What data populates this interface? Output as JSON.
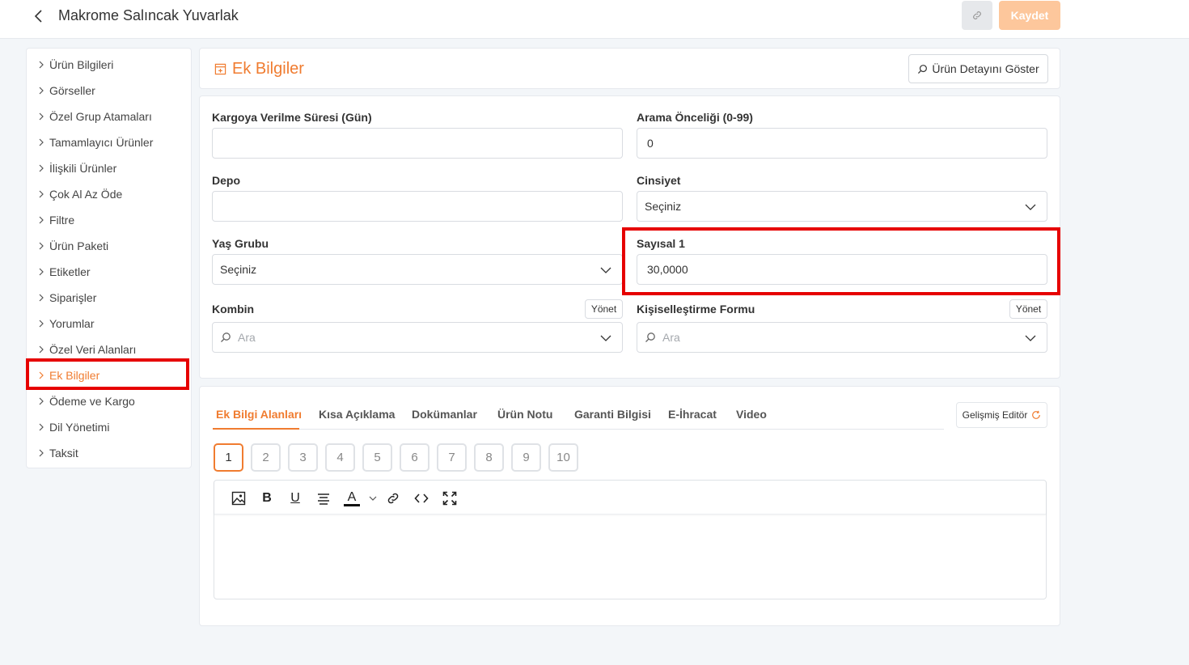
{
  "header": {
    "title": "Makrome Salıncak Yuvarlak",
    "save_label": "Kaydet"
  },
  "sidebar": {
    "items": [
      {
        "label": "Ürün Bilgileri"
      },
      {
        "label": "Görseller"
      },
      {
        "label": "Özel Grup Atamaları"
      },
      {
        "label": "Tamamlayıcı Ürünler"
      },
      {
        "label": "İlişkili Ürünler"
      },
      {
        "label": "Çok Al Az Öde"
      },
      {
        "label": "Filtre"
      },
      {
        "label": "Ürün Paketi"
      },
      {
        "label": "Etiketler"
      },
      {
        "label": "Siparişler"
      },
      {
        "label": "Yorumlar"
      },
      {
        "label": "Özel Veri Alanları"
      },
      {
        "label": "Ek Bilgiler"
      },
      {
        "label": "Ödeme ve Kargo"
      },
      {
        "label": "Dil Yönetimi"
      },
      {
        "label": "Taksit"
      }
    ],
    "active_item": "Ek Bilgiler"
  },
  "section": {
    "title": "Ek Bilgiler",
    "detail_button": "Ürün Detayını Göster"
  },
  "form": {
    "shipping_days": {
      "label": "Kargoya Verilme Süresi (Gün)",
      "value": ""
    },
    "search_priority": {
      "label": "Arama Önceliği (0-99)",
      "value": "0"
    },
    "warehouse": {
      "label": "Depo",
      "value": ""
    },
    "gender": {
      "label": "Cinsiyet",
      "value": "Seçiniz"
    },
    "age_group": {
      "label": "Yaş Grubu",
      "value": "Seçiniz"
    },
    "numeric1": {
      "label": "Sayısal 1",
      "value": "30,0000"
    },
    "combo": {
      "label": "Kombin",
      "manage": "Yönet",
      "placeholder": "Ara"
    },
    "personalization": {
      "label": "Kişiselleştirme Formu",
      "manage": "Yönet",
      "placeholder": "Ara"
    }
  },
  "tabs": [
    {
      "label": "Ek Bilgi Alanları"
    },
    {
      "label": "Kısa Açıklama"
    },
    {
      "label": "Dokümanlar"
    },
    {
      "label": "Ürün Notu"
    },
    {
      "label": "Garanti Bilgisi"
    },
    {
      "label": "E-İhracat"
    },
    {
      "label": "Video"
    }
  ],
  "advanced_editor": "Gelişmiş Editör",
  "number_buttons": [
    "1",
    "2",
    "3",
    "4",
    "5",
    "6",
    "7",
    "8",
    "9",
    "10"
  ],
  "editor": {
    "tools": [
      "image-icon",
      "bold-icon",
      "underline-icon",
      "align-icon",
      "text-color-icon",
      "link-icon",
      "code-icon",
      "fullscreen-icon"
    ],
    "bold_glyph": "B",
    "underline_glyph": "U",
    "color_glyph": "A"
  },
  "colors": {
    "accent": "#f07c30",
    "highlight": "#e60000",
    "save_bg": "#fdc79c"
  }
}
